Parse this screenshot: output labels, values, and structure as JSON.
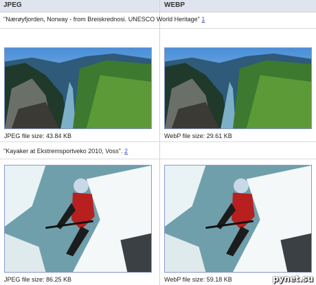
{
  "header": {
    "col_left": "JPEG",
    "col_right": "WEBP"
  },
  "rows": [
    {
      "caption": "\"Nærøyfjorden, Norway - from Breiskrednosi. UNESCO World Heritage\"",
      "ref": "1",
      "jpeg_size": "JPEG file size: 43.84 KB",
      "webp_size": "WebP file size: 29.61 KB"
    },
    {
      "caption": "\"Kayaker at Ekstremsportveko 2010, Voss\".",
      "ref": "2",
      "jpeg_size": "JPEG file size: 86.25 KB",
      "webp_size": "WebP file size: 59.18 KB"
    }
  ],
  "watermark": "pynet.su"
}
